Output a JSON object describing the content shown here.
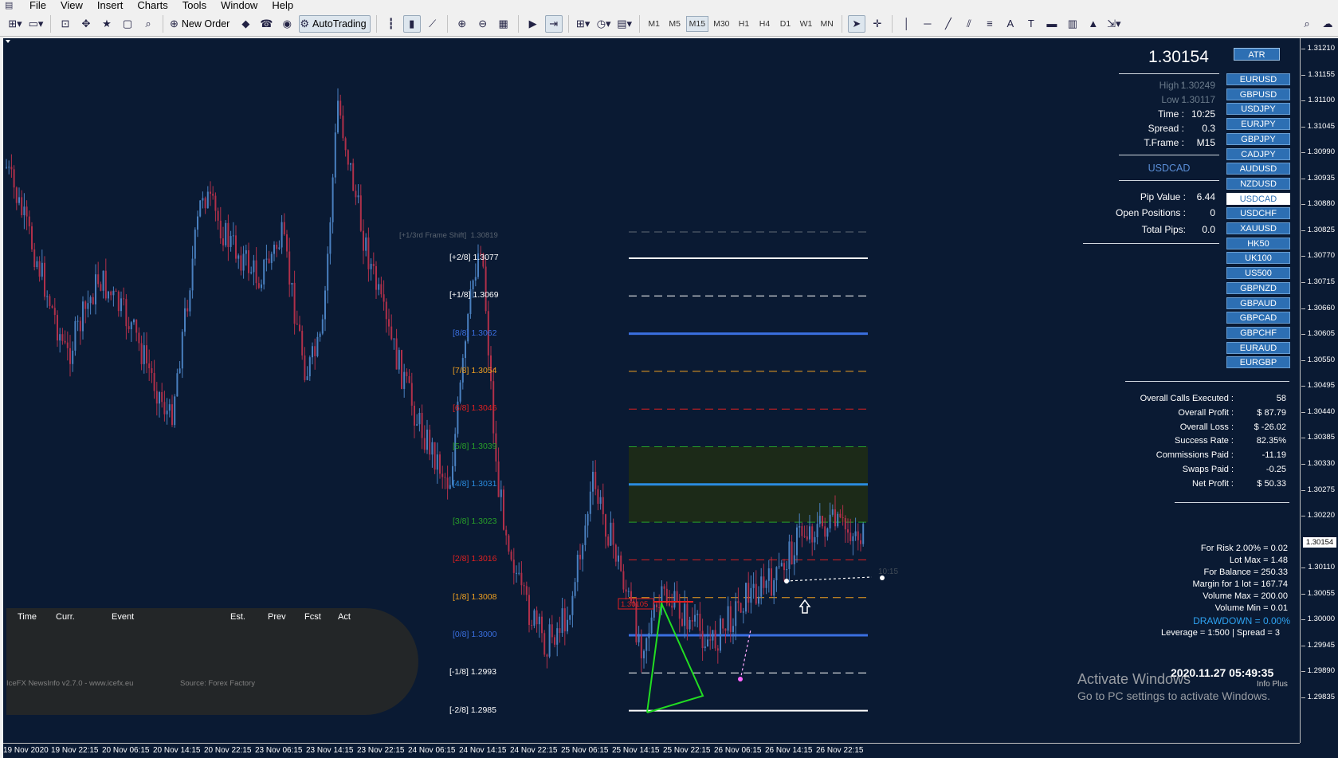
{
  "menu": [
    "File",
    "View",
    "Insert",
    "Charts",
    "Tools",
    "Window",
    "Help"
  ],
  "toolbar": {
    "new_order": "New Order",
    "autotrading": "AutoTrading",
    "timeframes": [
      "M1",
      "M5",
      "M15",
      "M30",
      "H1",
      "H4",
      "D1",
      "W1",
      "MN"
    ],
    "active_timeframe": "M15"
  },
  "price_axis": {
    "ticks": [
      "1.31210",
      "1.31155",
      "1.31100",
      "1.31045",
      "1.30990",
      "1.30935",
      "1.30880",
      "1.30825",
      "1.30770",
      "1.30715",
      "1.30660",
      "1.30605",
      "1.30550",
      "1.30495",
      "1.30440",
      "1.30385",
      "1.30330",
      "1.30275",
      "1.30220",
      "1.30154",
      "1.30110",
      "1.30055",
      "1.30000",
      "1.29945",
      "1.29890",
      "1.29835"
    ],
    "current": "1.30154"
  },
  "time_axis": [
    "19 Nov 2020",
    "19 Nov 22:15",
    "20 Nov 06:15",
    "20 Nov 14:15",
    "20 Nov 22:15",
    "23 Nov 06:15",
    "23 Nov 14:15",
    "23 Nov 22:15",
    "24 Nov 06:15",
    "24 Nov 14:15",
    "24 Nov 22:15",
    "25 Nov 06:15",
    "25 Nov 14:15",
    "25 Nov 22:15",
    "26 Nov 06:15",
    "26 Nov 14:15",
    "26 Nov 22:15"
  ],
  "murrey": {
    "shift_label": "[+1/3rd Frame Shift]",
    "shift_value": "1.30819",
    "levels": [
      {
        "label": "[+2/8]",
        "value": "1.3077",
        "color": "#ffffff"
      },
      {
        "label": "[+1/8]",
        "value": "1.3069",
        "color": "#ffffff"
      },
      {
        "label": "[8/8]",
        "value": "1.3062",
        "color": "#3a6fe0"
      },
      {
        "label": "[7/8]",
        "value": "1.3054",
        "color": "#f0a020"
      },
      {
        "label": "[6/8]",
        "value": "1.3046",
        "color": "#e02020"
      },
      {
        "label": "[5/8]",
        "value": "1.3039",
        "color": "#28a028"
      },
      {
        "label": "[4/8]",
        "value": "1.3031",
        "color": "#2a8ce0"
      },
      {
        "label": "[3/8]",
        "value": "1.3023",
        "color": "#28a028"
      },
      {
        "label": "[2/8]",
        "value": "1.3016",
        "color": "#e02020"
      },
      {
        "label": "[1/8]",
        "value": "1.3008",
        "color": "#f0a020"
      },
      {
        "label": "[0/8]",
        "value": "1.3000",
        "color": "#3a6fe0"
      },
      {
        "label": "[-1/8]",
        "value": "1.2993",
        "color": "#ffffff"
      },
      {
        "label": "[-2/8]",
        "value": "1.2985",
        "color": "#ffffff"
      }
    ],
    "box_price": "1.30105",
    "time_label": "10:15"
  },
  "news": {
    "headers": [
      "Time",
      "Curr.",
      "Event",
      "Est.",
      "Prev",
      "Fcst",
      "Act"
    ],
    "footer_left": "IceFX NewsInfo v2.7.0 - www.icefx.eu",
    "footer_right": "Source: Forex Factory"
  },
  "info": {
    "price": "1.30154",
    "atr": "ATR",
    "high_label": "High :",
    "high": "1.30249",
    "low_label": "Low :",
    "low": "1.30117",
    "time_label": "Time :",
    "time": "10:25",
    "spread_label": "Spread :",
    "spread": "0.3",
    "tframe_label": "T.Frame :",
    "tframe": "M15",
    "symbol": "USDCAD",
    "pip_label": "Pip Value :",
    "pip": "6.44",
    "open_label": "Open Positions :",
    "open": "0",
    "pips_label": "Total Pips:",
    "pips": "0.0",
    "symbols": [
      "EURUSD",
      "GBPUSD",
      "USDJPY",
      "EURJPY",
      "GBPJPY",
      "CADJPY",
      "AUDUSD",
      "NZDUSD",
      "USDCAD",
      "USDCHF",
      "XAUUSD",
      "HK50",
      "UK100",
      "US500",
      "GBPNZD",
      "GBPAUD",
      "GBPCAD",
      "GBPCHF",
      "EURAUD",
      "EURGBP"
    ],
    "selected_symbol": "USDCAD",
    "stats": [
      {
        "label": "Overall Calls Executed :",
        "value": "58"
      },
      {
        "label": "Overall Profit :",
        "value": "$ 87.79"
      },
      {
        "label": "Overall Loss :",
        "value": "$ -26.02"
      },
      {
        "label": "Success Rate :",
        "value": "82.35%"
      },
      {
        "label": "Commissions Paid :",
        "value": "-11.19"
      },
      {
        "label": "Swaps Paid :",
        "value": "-0.25"
      },
      {
        "label": "Net Profit :",
        "value": "$ 50.33"
      }
    ],
    "risk": [
      "For Risk 2.00% = 0.02",
      "Lot Max = 1.48",
      "For Balance = 250.33",
      "Margin for 1 lot = 167.74",
      "Volume Max = 200.00",
      "Volume Min = 0.01"
    ],
    "drawdown": "DRAWDOWN =  0.00%",
    "leverage": "Leverage = 1:500 | Spread = 3",
    "datetime": "2020.11.27 05:49:35",
    "infoplus": "Info Plus"
  },
  "watermark": {
    "line1": "Activate Windows",
    "line2": "Go to PC settings to activate Windows."
  }
}
